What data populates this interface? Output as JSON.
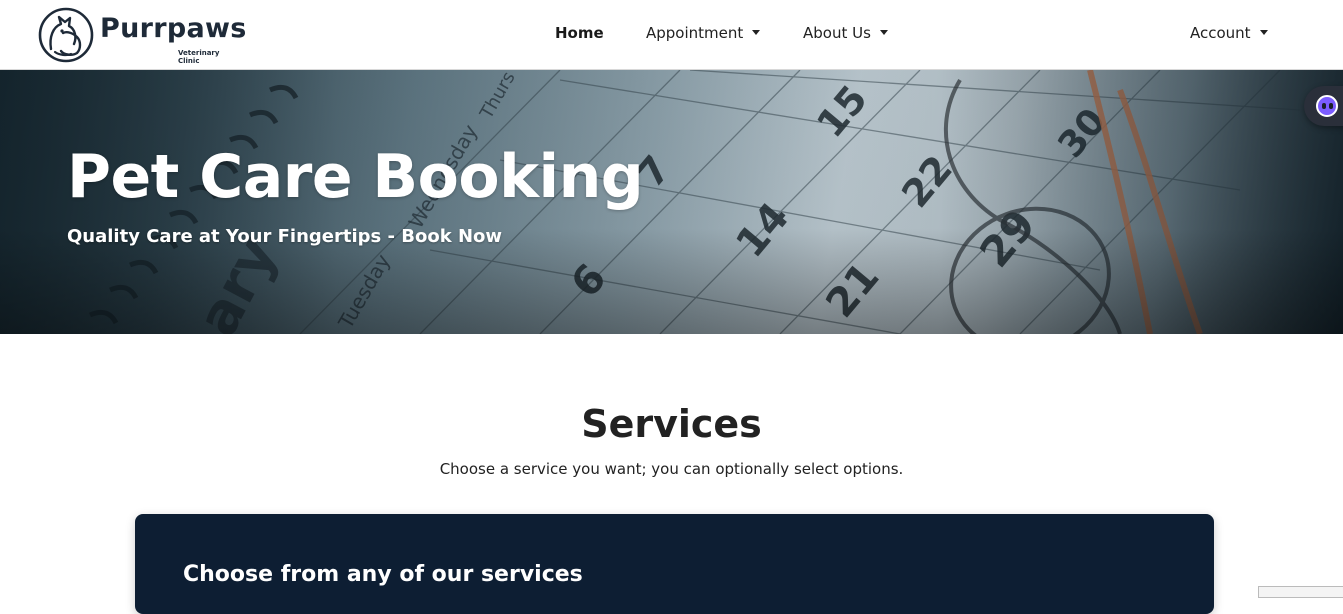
{
  "brand": {
    "name": "Purrpaws",
    "subtitle": "Veterinary Clinic",
    "logo_icon": "cat-dog-logo-icon"
  },
  "nav": {
    "items": [
      {
        "label": "Home",
        "active": true,
        "dropdown": false
      },
      {
        "label": "Appointment",
        "active": false,
        "dropdown": true
      },
      {
        "label": "About Us",
        "active": false,
        "dropdown": true
      }
    ],
    "account": {
      "label": "Account",
      "dropdown": true
    }
  },
  "hero": {
    "title": "Pet Care Booking",
    "subtitle": "Quality Care at Your Fingertips - Book Now",
    "background": "calendar-with-glasses-photo"
  },
  "services": {
    "heading": "Services",
    "description": "Choose a service you want; you can optionally select options.",
    "card_title": "Choose from any of our services"
  },
  "colors": {
    "navbar_bg": "#ffffff",
    "brand_text": "#1e2a38",
    "card_bg": "#0d1e33",
    "widget_accent": "#7b5cff"
  },
  "widget": {
    "icon": "chat-assistant-icon"
  }
}
